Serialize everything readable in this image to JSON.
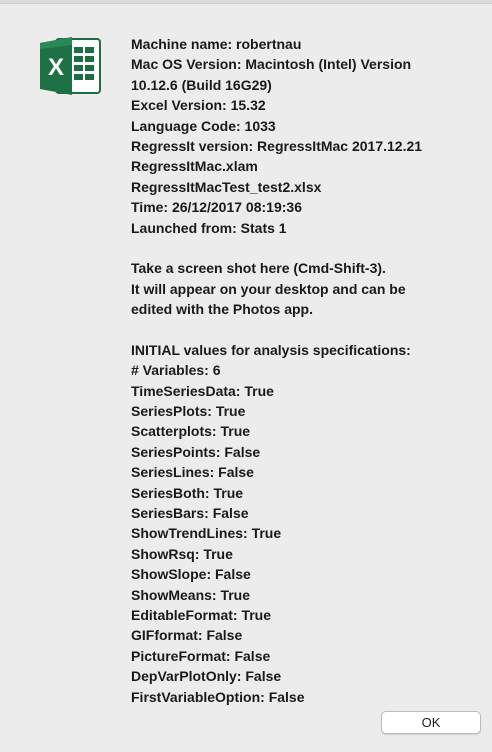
{
  "dialog": {
    "app_icon": "excel-icon",
    "info": [
      "Machine name:  robertnau",
      "Mac OS Version: Macintosh (Intel) Version",
      "10.12.6 (Build 16G29)",
      "Excel Version: 15.32",
      "Language Code: 1033",
      "RegressIt version: RegressItMac 2017.12.21",
      "RegressItMac.xlam",
      "RegressItMacTest_test2.xlsx",
      "Time: 26/12/2017 08:19:36",
      "Launched from: Stats 1"
    ],
    "instructions": [
      "Take a screen shot here (Cmd-Shift-3).",
      "It will appear on your desktop and can be",
      "edited with the Photos app."
    ],
    "specs_title": "INITIAL values for analysis specifications:",
    "specs": [
      "# Variables: 6",
      "TimeSeriesData: True",
      "SeriesPlots: True",
      "Scatterplots: True",
      "SeriesPoints: False",
      "SeriesLines: False",
      "SeriesBoth: True",
      "SeriesBars: False",
      "ShowTrendLines: True",
      "ShowRsq: True",
      "ShowSlope: False",
      "ShowMeans: True",
      "EditableFormat: True",
      "GIFformat: False",
      "PictureFormat: False",
      "DepVarPlotOnly: False",
      "FirstVariableOption: False"
    ],
    "ok_label": "OK"
  }
}
